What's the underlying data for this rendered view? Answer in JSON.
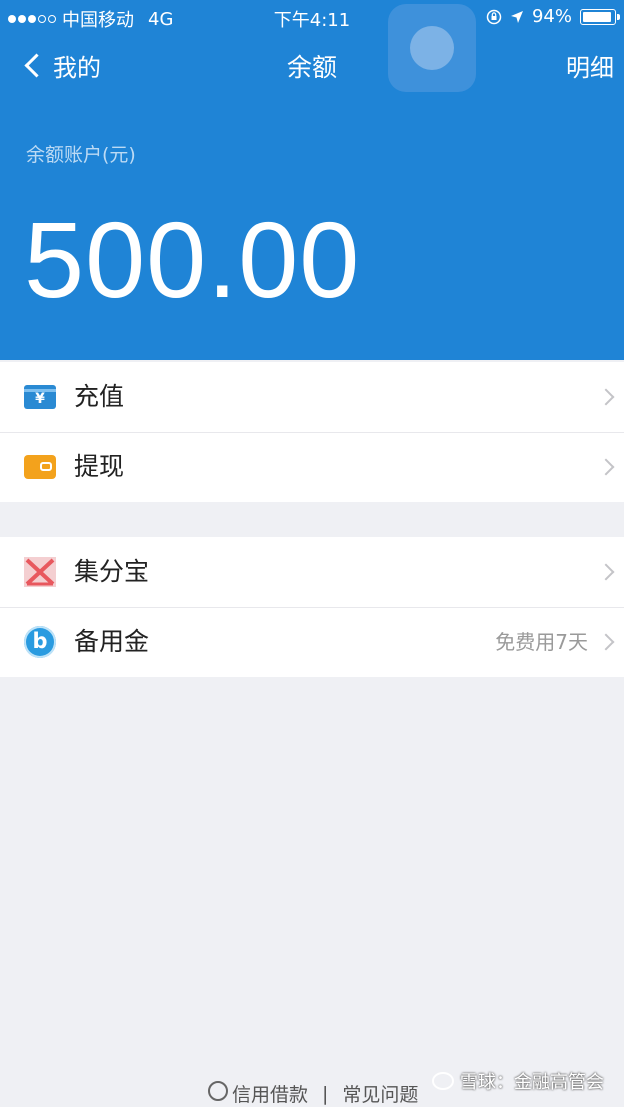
{
  "status_bar": {
    "carrier": "中国移动",
    "network": "4G",
    "time": "下午4:11",
    "battery_text": "94%",
    "battery_level": 0.94
  },
  "nav": {
    "back_label": "我的",
    "title": "余额",
    "detail_label": "明细"
  },
  "balance": {
    "label": "余额账户(元)",
    "amount": "500.00"
  },
  "group1": [
    {
      "label": "充值",
      "icon": "recharge-icon",
      "icon_glyph": "¥"
    },
    {
      "label": "提现",
      "icon": "wallet-icon"
    }
  ],
  "group2": [
    {
      "label": "集分宝",
      "icon": "points-icon"
    },
    {
      "label": "备用金",
      "icon": "backup-fund-icon",
      "icon_glyph": "b",
      "note": "免费用7天"
    }
  ],
  "footer": {
    "link1": "信用借款",
    "separator": "|",
    "link2": "常见问题",
    "watermark": "雪球：金融高管会"
  },
  "colors": {
    "header_bg": "#1f84d6",
    "page_bg": "#eff0f4",
    "recharge_icon": "#2a8ad3",
    "withdraw_icon": "#f3a21c",
    "points_icon": "#e8585e",
    "backup_icon": "#2a9be0"
  }
}
